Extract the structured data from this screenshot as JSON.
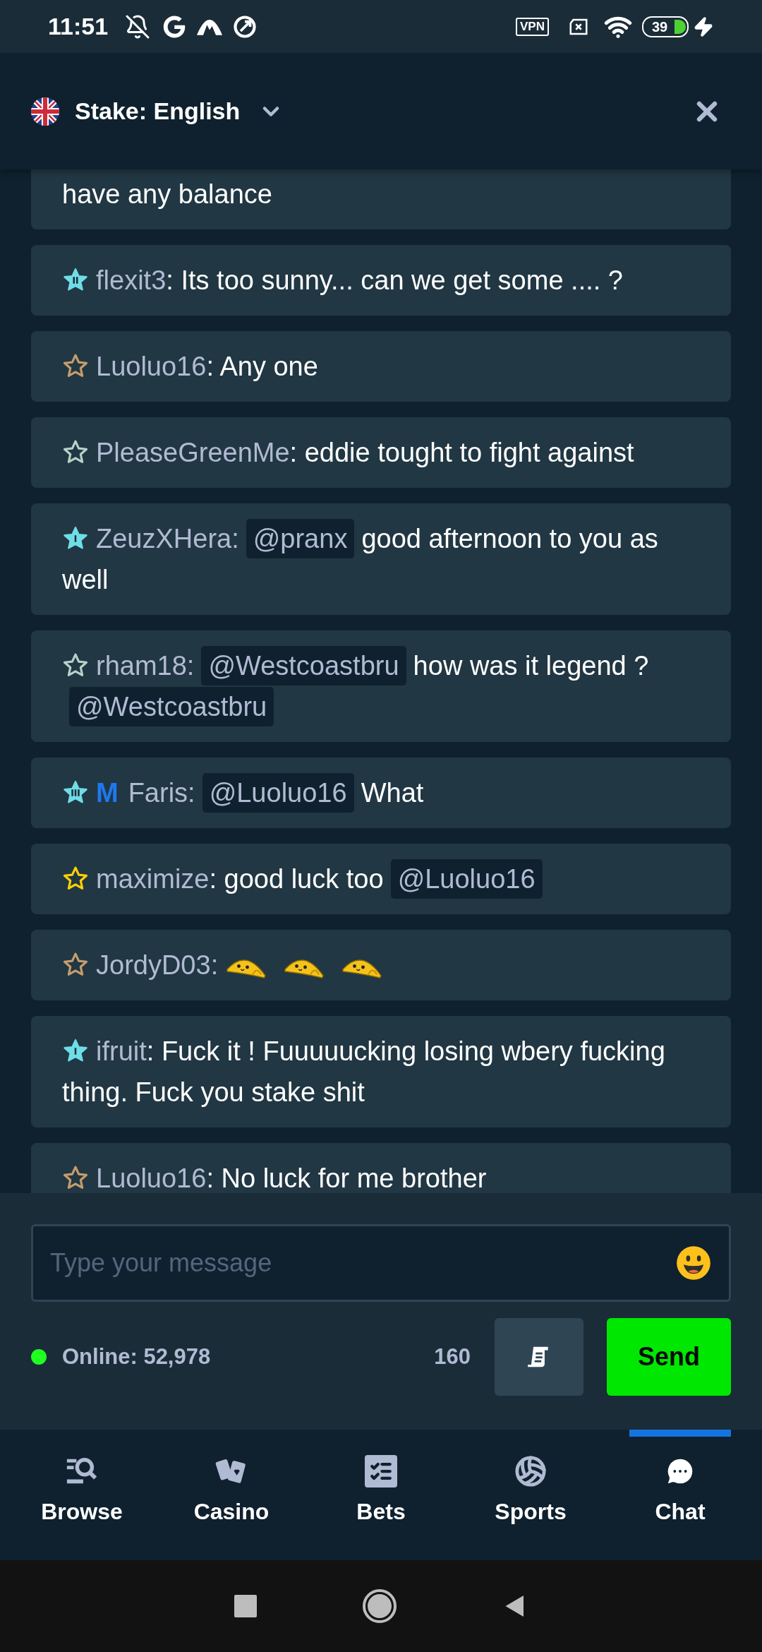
{
  "status_bar": {
    "time": "11:51",
    "vpn_label": "VPN",
    "battery": "39"
  },
  "header": {
    "title": "Stake: English"
  },
  "messages": [
    {
      "kind": "continuation",
      "parts": [
        {
          "kind": "text",
          "text": "have any balance"
        }
      ]
    },
    {
      "kind": "message",
      "badge": {
        "kind": "platinum-2"
      },
      "user": "flexit3",
      "parts": [
        {
          "kind": "text",
          "text": ": Its too sunny... can we get some .... ?"
        }
      ]
    },
    {
      "kind": "message",
      "badge": {
        "kind": "bronze"
      },
      "user": "Luoluo16",
      "parts": [
        {
          "kind": "text",
          "text": ": Any one"
        }
      ]
    },
    {
      "kind": "message",
      "badge": {
        "kind": "silver"
      },
      "user": "PleaseGreenMe",
      "parts": [
        {
          "kind": "text",
          "text": ": eddie tought to fight against"
        }
      ]
    },
    {
      "kind": "message",
      "badge": {
        "kind": "platinum-1"
      },
      "user": "ZeuzXHera:",
      "parts": [
        {
          "kind": "mention",
          "text": "@pranx"
        },
        {
          "kind": "text",
          "text": "good afternoon to you as well"
        }
      ]
    },
    {
      "kind": "message",
      "badge": {
        "kind": "silver"
      },
      "user": "rham18:",
      "parts": [
        {
          "kind": "mention",
          "text": "@Westcoastbru"
        },
        {
          "kind": "text",
          "text": "how was it legend ?"
        },
        {
          "kind": "mention",
          "text": "@Westcoastbru"
        }
      ]
    },
    {
      "kind": "message",
      "badge": {
        "kind": "platinum-3"
      },
      "tag": "M",
      "user": "Faris:",
      "parts": [
        {
          "kind": "mention",
          "text": "@Luoluo16"
        },
        {
          "kind": "text",
          "text": "What"
        }
      ]
    },
    {
      "kind": "message",
      "badge": {
        "kind": "gold"
      },
      "user": "maximize",
      "parts": [
        {
          "kind": "text",
          "text": ": good luck too"
        },
        {
          "kind": "mention",
          "text": "@Luoluo16"
        }
      ]
    },
    {
      "kind": "message",
      "badge": {
        "kind": "bronze"
      },
      "user": "JordyD03:",
      "parts": [
        {
          "kind": "emoji"
        },
        {
          "kind": "emoji"
        },
        {
          "kind": "emoji"
        }
      ]
    },
    {
      "kind": "message",
      "badge": {
        "kind": "platinum-1"
      },
      "user": "ifruit",
      "parts": [
        {
          "kind": "text",
          "text": ": Fuck it ! Fuuuuucking losing wbery fucking thing. Fuck you stake shit"
        }
      ]
    },
    {
      "kind": "message",
      "badge": {
        "kind": "bronze"
      },
      "user": "Luoluo16",
      "parts": [
        {
          "kind": "text",
          "text": ": No luck for me brother"
        }
      ]
    }
  ],
  "composer": {
    "placeholder": "Type your message",
    "online": "Online: 52,978",
    "char_count": "160",
    "send": "Send"
  },
  "nav": [
    {
      "kind": "browse",
      "label": "Browse",
      "selected": false
    },
    {
      "kind": "casino",
      "label": "Casino",
      "selected": false
    },
    {
      "kind": "bets",
      "label": "Bets",
      "selected": false
    },
    {
      "kind": "sports",
      "label": "Sports",
      "selected": false
    },
    {
      "kind": "chat",
      "label": "Chat",
      "selected": true
    }
  ]
}
